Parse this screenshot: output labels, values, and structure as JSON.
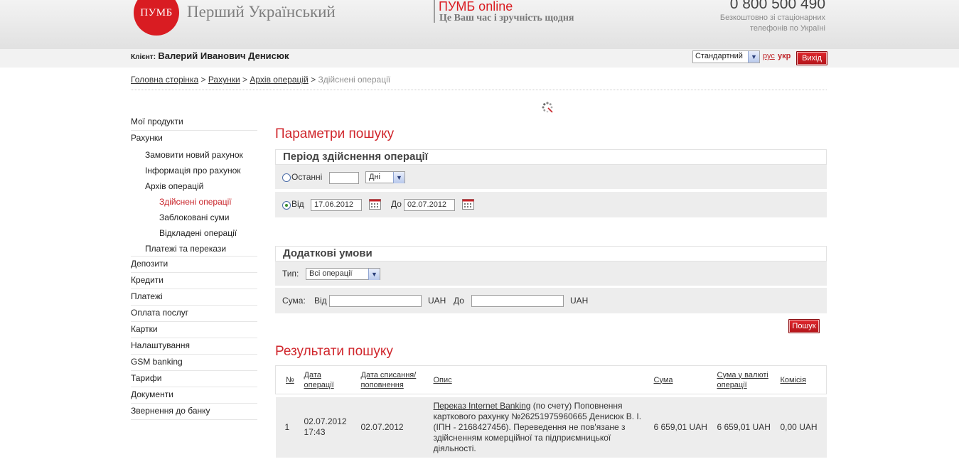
{
  "header": {
    "logo_mark": "ПУМБ",
    "bank_name": "Перший Український",
    "online_title": "ПУМБ online",
    "online_tagline": "Це Ваш час і зручність щодня",
    "phone": "0 800 500 490",
    "phone_note": "Безкоштовно зі стаціонарних телефонів по Україні",
    "brand_color": "#d91c22"
  },
  "clientbar": {
    "client_label": "Клієнт:",
    "client_name": "Валерий Иванович Денисюк",
    "theme_value": "Стандартний",
    "lang_rus": "рус",
    "lang_ukr": "укр",
    "logout": "Вихід"
  },
  "breadcrumb": {
    "items": [
      "Головна сторінка",
      "Рахунки",
      "Архів операцій"
    ],
    "current": "Здійснені операції",
    "sep": ">"
  },
  "sidebar": {
    "items": [
      "Мої продукти",
      "Рахунки",
      "Замовити новий рахунок",
      "Інформація про рахунок",
      "Архів операцій",
      "Здійснені операції",
      "Заблоковані суми",
      "Відкладені операції",
      "Платежі та перекази",
      "Депозити",
      "Кредити",
      "Платежі",
      "Оплата послуг",
      "Картки",
      "Налаштування",
      "GSM banking",
      "Тарифи",
      "Документи",
      "Звернення до банку"
    ]
  },
  "search": {
    "title": "Параметри пошуку",
    "period_title": "Період здійснення операції",
    "last_label": "Останні",
    "last_value": "",
    "last_unit": "Дні",
    "from_label": "Від",
    "from_value": "17.06.2012",
    "to_label": "До",
    "to_value": "02.07.2012",
    "extra_title": "Додаткові умови",
    "type_label": "Тип:",
    "type_value": "Всі операції",
    "sum_label": "Сума:",
    "sum_from_label": "Від",
    "sum_to_label": "До",
    "currency": "UAH",
    "search_button": "Пошук"
  },
  "results": {
    "title": "Результати пошуку",
    "columns": [
      "№",
      "Дата операції",
      "Дата списання/ поповнення",
      "Опис",
      "Сума",
      "Сума у валюті операції",
      "Комісія"
    ],
    "rows": [
      {
        "num": "1",
        "op_date": "02.07.2012 17:43",
        "post_date": "02.07.2012",
        "desc_link": "Переказ Internet Banking",
        "desc_rest": " (по счету) Поповнення карткового рахунку №26251975960665 Денисюк В. І. (ІПН - 2168427456). Переведення не пов'язане з здійсненням комерційної та підприємницької діяльності.",
        "amount": "6 659,01 UAH",
        "amount_op": "6 659,01 UAH",
        "fee": "0,00 UAH"
      }
    ]
  }
}
